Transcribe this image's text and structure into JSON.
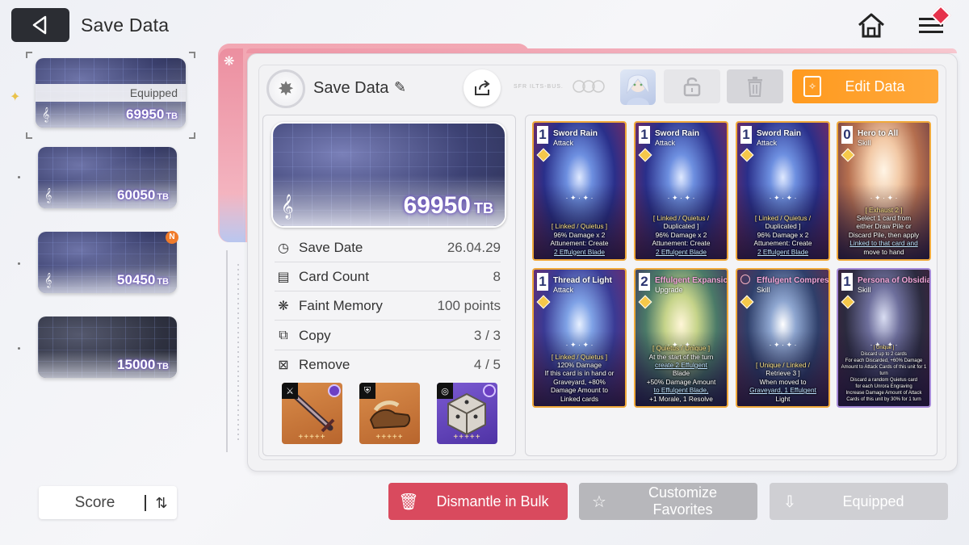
{
  "header": {
    "title": "Save Data"
  },
  "slots": [
    {
      "value": "69950",
      "unit": "TB",
      "status": "Equipped",
      "selected": true
    },
    {
      "value": "60050",
      "unit": "TB"
    },
    {
      "value": "50450",
      "unit": "TB",
      "badge": "N"
    },
    {
      "value": "15000",
      "unit": "TB"
    }
  ],
  "sort": {
    "label": "Score"
  },
  "panel": {
    "save_name": "Save Data",
    "edit_label": "Edit Data",
    "tiny_text": "SFR ILTS-BUS."
  },
  "detail": {
    "value": "69950",
    "unit": "TB",
    "stats": [
      {
        "label": "Save Date",
        "value": "26.04.29",
        "icon": "clock-icon"
      },
      {
        "label": "Card Count",
        "value": "8",
        "icon": "cards-icon"
      },
      {
        "label": "Faint Memory",
        "value": "100 points",
        "icon": "brain-icon"
      },
      {
        "label": "Copy",
        "value": "3 / 3",
        "icon": "copy-icon"
      },
      {
        "label": "Remove",
        "value": "4 / 5",
        "icon": "remove-icon"
      }
    ],
    "equipment": [
      {
        "name": "weapon",
        "tag": "sword-icon",
        "stars": "+++++"
      },
      {
        "name": "armor",
        "tag": "armor-icon",
        "stars": "+++++"
      },
      {
        "name": "accessory",
        "tag": "ring-icon",
        "stars": "+++++"
      }
    ]
  },
  "cards": [
    {
      "cost": "1",
      "name": "Sword Rain",
      "type": "Attack",
      "lines": [
        "[ Linked / Quietus ]",
        "96% Damage x 2",
        "Attunement: Create",
        "2 Effulgent Blade"
      ]
    },
    {
      "cost": "1",
      "name": "Sword Rain",
      "type": "Attack",
      "lines": [
        "[ Linked / Quietus /",
        "Duplicated ]",
        "96% Damage x 2",
        "Attunement: Create",
        "2 Effulgent Blade"
      ]
    },
    {
      "cost": "1",
      "name": "Sword Rain",
      "type": "Attack",
      "lines": [
        "[ Linked / Quietus /",
        "Duplicated ]",
        "96% Damage x 2",
        "Attunement: Create",
        "2 Effulgent Blade"
      ]
    },
    {
      "cost": "0",
      "name": "Hero to All",
      "type": "Skill",
      "lines": [
        "[ Exhaust 2 ]",
        "Select 1 card from",
        "either Draw Pile or",
        "Discard Pile, then apply",
        "Linked to that card and",
        "move to hand"
      ]
    },
    {
      "cost": "1",
      "name": "Thread of Light",
      "type": "Attack",
      "lines": [
        "[ Linked / Quietus ]",
        "120% Damage",
        "If this card is in hand or",
        "Graveyard, +80%",
        "Damage Amount to",
        "Linked cards"
      ]
    },
    {
      "cost": "2",
      "name": "Effulgent Expansion",
      "type": "Upgrade",
      "lines": [
        "[ Quietus / Unique ]",
        "At the start of the turn",
        "create 2 Effulgent",
        "Blade",
        "+50% Damage Amount",
        "to Effulgent Blade,",
        "+1 Morale, 1 Resolve"
      ]
    },
    {
      "cost": "",
      "name": "Effulgent Compression",
      "type": "Skill",
      "lines": [
        "[ Unique / Linked /",
        "Retrieve 3 ]",
        "When moved to",
        "Graveyard, 1 Effulgent",
        "Light"
      ]
    },
    {
      "cost": "1",
      "name": "Persona of Obsidian",
      "type": "Skill",
      "lines": [
        "[ Unique ]",
        "Discard up to 2 cards",
        "For each Discarded, +60% Damage",
        "Amount to Attack Cards of this unit for 1",
        "turn",
        "Discard a random Quietus card",
        "for each Unrora Engraving",
        "Increase Damage Amount of Attack",
        "Cards of this unit by 30% for 1 turn"
      ]
    }
  ],
  "bottom": {
    "dismantle": "Dismantle in Bulk",
    "customize": "Customize Favorites",
    "equipped": "Equipped"
  },
  "colors": {
    "accent_orange": "#ff9a1f",
    "dismantle_red": "#d94a5e",
    "panel_pink": "#f2a7b3",
    "card_border": "#f0a93a"
  }
}
